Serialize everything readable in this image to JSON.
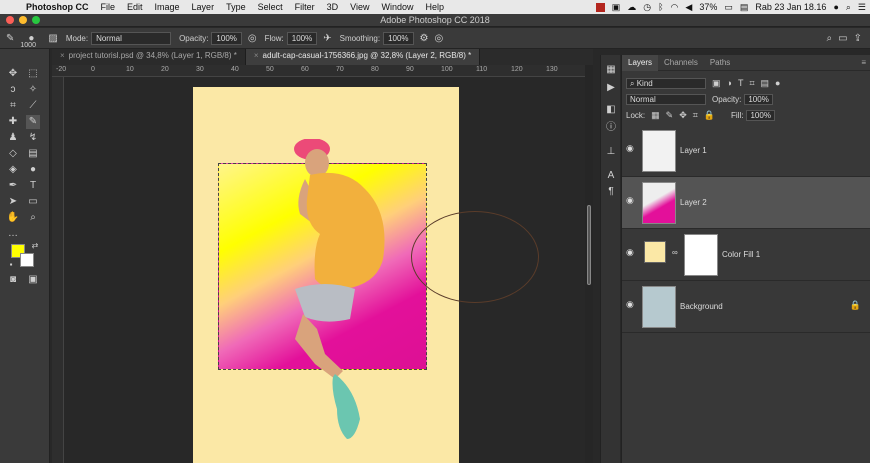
{
  "menubar": {
    "app_name": "Photoshop CC",
    "menus": [
      "File",
      "Edit",
      "Image",
      "Layer",
      "Type",
      "Select",
      "Filter",
      "3D",
      "View",
      "Window",
      "Help"
    ],
    "battery": "37%",
    "datetime": "Rab 23 Jan  18.16"
  },
  "window": {
    "title": "Adobe Photoshop CC 2018"
  },
  "options": {
    "brush_size": "1000",
    "mode_label": "Mode:",
    "mode_value": "Normal",
    "opacity_label": "Opacity:",
    "opacity_value": "100%",
    "flow_label": "Flow:",
    "flow_value": "100%",
    "smoothing_label": "Smoothing:",
    "smoothing_value": "100%"
  },
  "tabs": [
    {
      "label": "project tutorisl.psd @ 34,8% (Layer 1, RGB/8) *"
    },
    {
      "label": "adult-cap-casual-1756366.jpg @ 32,8% (Layer 2, RGB/8) *"
    }
  ],
  "rulers": {
    "top": [
      "-20",
      "0",
      "10",
      "20",
      "30",
      "40",
      "50",
      "60",
      "70",
      "80",
      "90",
      "100",
      "110",
      "120",
      "130"
    ]
  },
  "colors": {
    "foreground": "#ffff00",
    "background": "#ffffff",
    "document_fill": "#fbe8a6",
    "accent_magenta": "#e3109a"
  },
  "layers_panel": {
    "tabs": [
      "Layers",
      "Channels",
      "Paths"
    ],
    "kind_value": "Kind",
    "blend_value": "Normal",
    "opacity_label": "Opacity:",
    "opacity_value": "100%",
    "lock_label": "Lock:",
    "fill_label": "Fill:",
    "fill_value": "100%",
    "layers": [
      {
        "name": "Layer 1"
      },
      {
        "name": "Layer 2"
      },
      {
        "name": "Color Fill 1"
      },
      {
        "name": "Background"
      }
    ]
  }
}
